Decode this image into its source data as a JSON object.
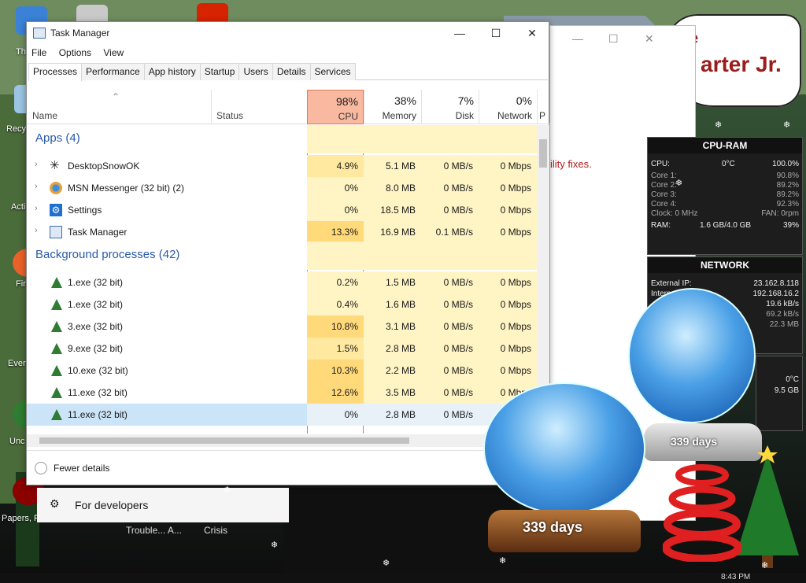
{
  "desktop": {
    "banner_fragment": "arter Jr.",
    "banner_letter": "e",
    "icon_labels": [
      "Th",
      "Recy",
      "Acti",
      "Fir",
      "Ever",
      "Unc",
      "Papers, P"
    ],
    "taskbar_labels": [
      "Trouble... A...",
      "Crisis"
    ],
    "clock": "8:43 PM"
  },
  "background_window": {
    "message": "ility fixes."
  },
  "task_manager": {
    "title": "Task Manager",
    "controls": {
      "minimize": "—",
      "maximize": "☐",
      "close": "✕"
    },
    "menu": [
      "File",
      "Options",
      "View"
    ],
    "tabs": [
      "Processes",
      "Performance",
      "App history",
      "Startup",
      "Users",
      "Details",
      "Services"
    ],
    "active_tab": "Processes",
    "columns": {
      "name": "Name",
      "status": "Status",
      "cpu": {
        "pct": "98%",
        "label": "CPU"
      },
      "memory": {
        "pct": "38%",
        "label": "Memory"
      },
      "disk": {
        "pct": "7%",
        "label": "Disk"
      },
      "network": {
        "pct": "0%",
        "label": "Network"
      },
      "power": "P"
    },
    "apps_header": "Apps (4)",
    "apps": [
      {
        "name": "DesktopSnowOK",
        "cpu": "4.9%",
        "memory": "5.1 MB",
        "disk": "0 MB/s",
        "network": "0 Mbps"
      },
      {
        "name": "MSN Messenger (32 bit) (2)",
        "cpu": "0%",
        "memory": "8.0 MB",
        "disk": "0 MB/s",
        "network": "0 Mbps"
      },
      {
        "name": "Settings",
        "cpu": "0%",
        "memory": "18.5 MB",
        "disk": "0 MB/s",
        "network": "0 Mbps"
      },
      {
        "name": "Task Manager",
        "cpu": "13.3%",
        "memory": "16.9 MB",
        "disk": "0.1 MB/s",
        "network": "0 Mbps"
      }
    ],
    "bg_header": "Background processes (42)",
    "background": [
      {
        "name": "1.exe (32 bit)",
        "cpu": "0.2%",
        "memory": "1.5 MB",
        "disk": "0 MB/s",
        "network": "0 Mbps"
      },
      {
        "name": "1.exe (32 bit)",
        "cpu": "0.4%",
        "memory": "1.6 MB",
        "disk": "0 MB/s",
        "network": "0 Mbps"
      },
      {
        "name": "3.exe (32 bit)",
        "cpu": "10.8%",
        "memory": "3.1 MB",
        "disk": "0 MB/s",
        "network": "0 Mbps"
      },
      {
        "name": "9.exe (32 bit)",
        "cpu": "1.5%",
        "memory": "2.8 MB",
        "disk": "0 MB/s",
        "network": "0 Mbps"
      },
      {
        "name": "10.exe (32 bit)",
        "cpu": "10.3%",
        "memory": "2.2 MB",
        "disk": "0 MB/s",
        "network": "0 Mbps"
      },
      {
        "name": "11.exe (32 bit)",
        "cpu": "12.6%",
        "memory": "3.5 MB",
        "disk": "0 MB/s",
        "network": "0 Mbps"
      },
      {
        "name": "11.exe (32 bit)",
        "cpu": "0%",
        "memory": "2.8 MB",
        "disk": "0 MB/s",
        "network": "0 Mbps"
      }
    ],
    "footer": "Fewer details"
  },
  "developer_bar": {
    "label": "For developers"
  },
  "cpu_ram_widget": {
    "title": "CPU-RAM",
    "cpu_label": "CPU:",
    "cpu_temp": "0°C",
    "cpu_pct": "100.0%",
    "cores": [
      {
        "label": "Core 1:",
        "value": "90.8%"
      },
      {
        "label": "Core 2:",
        "value": "89.2%"
      },
      {
        "label": "Core 3:",
        "value": "89.2%"
      },
      {
        "label": "Core 4:",
        "value": "92.3%"
      }
    ],
    "clock": "Clock: 0 MHz",
    "fan": "FAN: 0rpm",
    "ram_label": "RAM:",
    "ram_value": "1.6 GB/4.0 GB",
    "ram_pct": "39%"
  },
  "network_widget": {
    "title": "NETWORK",
    "external_label": "External IP:",
    "external_ip": "23.162.8.118",
    "internal_label": "Internal",
    "internal_ip": "192.168.16.2",
    "speed1": "19.6 kB/s",
    "speed2": "69.2 kB/s",
    "speed3": "22.3 MB"
  },
  "drive_widget": {
    "temp": "0°C",
    "size": "9.5 GB"
  },
  "globes": [
    {
      "days": "339 days"
    },
    {
      "days": "339 days"
    }
  ],
  "colors": {
    "accent": "#2a5aa8",
    "cpu_header": "#f9b9a0",
    "heat_light": "#fff4c4",
    "heat_mid": "#ffe9a0",
    "heat_strong": "#ffd97a"
  }
}
